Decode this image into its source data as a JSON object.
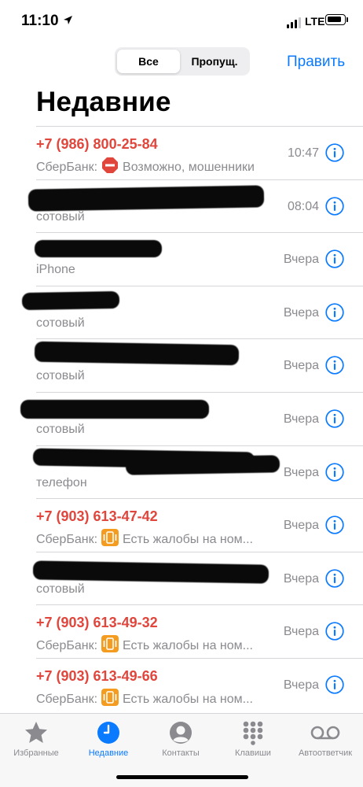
{
  "status": {
    "time": "11:10",
    "network": "LTE"
  },
  "header": {
    "segments": [
      "Все",
      "Пропущ."
    ],
    "edit_label": "Править",
    "title": "Недавние"
  },
  "calls": [
    {
      "name": "+7 (986) 800-25-84",
      "missed": true,
      "sub_prefix": "СберБанк:",
      "sub_icon": "stop-sign-icon",
      "sub_text": "Возможно, мошенники",
      "time": "10:47",
      "redacted": false
    },
    {
      "name": "",
      "missed": false,
      "sub_prefix": "",
      "sub_icon": "",
      "sub_text": "сотовый",
      "time": "08:04",
      "redacted": true
    },
    {
      "name": "",
      "missed": false,
      "sub_prefix": "",
      "sub_icon": "",
      "sub_text": "iPhone",
      "time": "Вчера",
      "redacted": true
    },
    {
      "name": "",
      "missed": false,
      "sub_prefix": "",
      "sub_icon": "",
      "sub_text": "сотовый",
      "time": "Вчера",
      "redacted": true
    },
    {
      "name": "",
      "missed": false,
      "sub_prefix": "",
      "sub_icon": "",
      "sub_text": "сотовый",
      "time": "Вчера",
      "redacted": true
    },
    {
      "name": "",
      "missed": false,
      "sub_prefix": "",
      "sub_icon": "",
      "sub_text": "сотовый",
      "time": "Вчера",
      "redacted": true
    },
    {
      "name": "",
      "missed": false,
      "sub_prefix": "",
      "sub_icon": "",
      "sub_text": "телефон",
      "time": "Вчера",
      "redacted": true
    },
    {
      "name": "+7 (903) 613-47-42",
      "missed": true,
      "sub_prefix": "СберБанк:",
      "sub_icon": "vibrating-phone-icon",
      "sub_text": "Есть жалобы на ном...",
      "time": "Вчера",
      "redacted": false
    },
    {
      "name": "",
      "missed": false,
      "sub_prefix": "",
      "sub_icon": "",
      "sub_text": "сотовый",
      "time": "Вчера",
      "redacted": true
    },
    {
      "name": "+7 (903) 613-49-32",
      "missed": true,
      "sub_prefix": "СберБанк:",
      "sub_icon": "vibrating-phone-icon",
      "sub_text": "Есть жалобы на ном...",
      "time": "Вчера",
      "redacted": false
    },
    {
      "name": "+7 (903) 613-49-66",
      "missed": true,
      "sub_prefix": "СберБанк:",
      "sub_icon": "vibrating-phone-icon",
      "sub_text": "Есть жалобы на ном...",
      "time": "Вчера",
      "redacted": false
    }
  ],
  "tabs": [
    {
      "label": "Избранные",
      "icon": "star-icon",
      "active": false
    },
    {
      "label": "Недавние",
      "icon": "clock-icon",
      "active": true
    },
    {
      "label": "Контакты",
      "icon": "person-circle-icon",
      "active": false
    },
    {
      "label": "Клавиши",
      "icon": "keypad-icon",
      "active": false
    },
    {
      "label": "Автоответчик",
      "icon": "voicemail-icon",
      "active": false
    }
  ],
  "colors": {
    "accent": "#0a7aff",
    "missed": "#e0463c",
    "secondary": "#8a8a8f"
  }
}
